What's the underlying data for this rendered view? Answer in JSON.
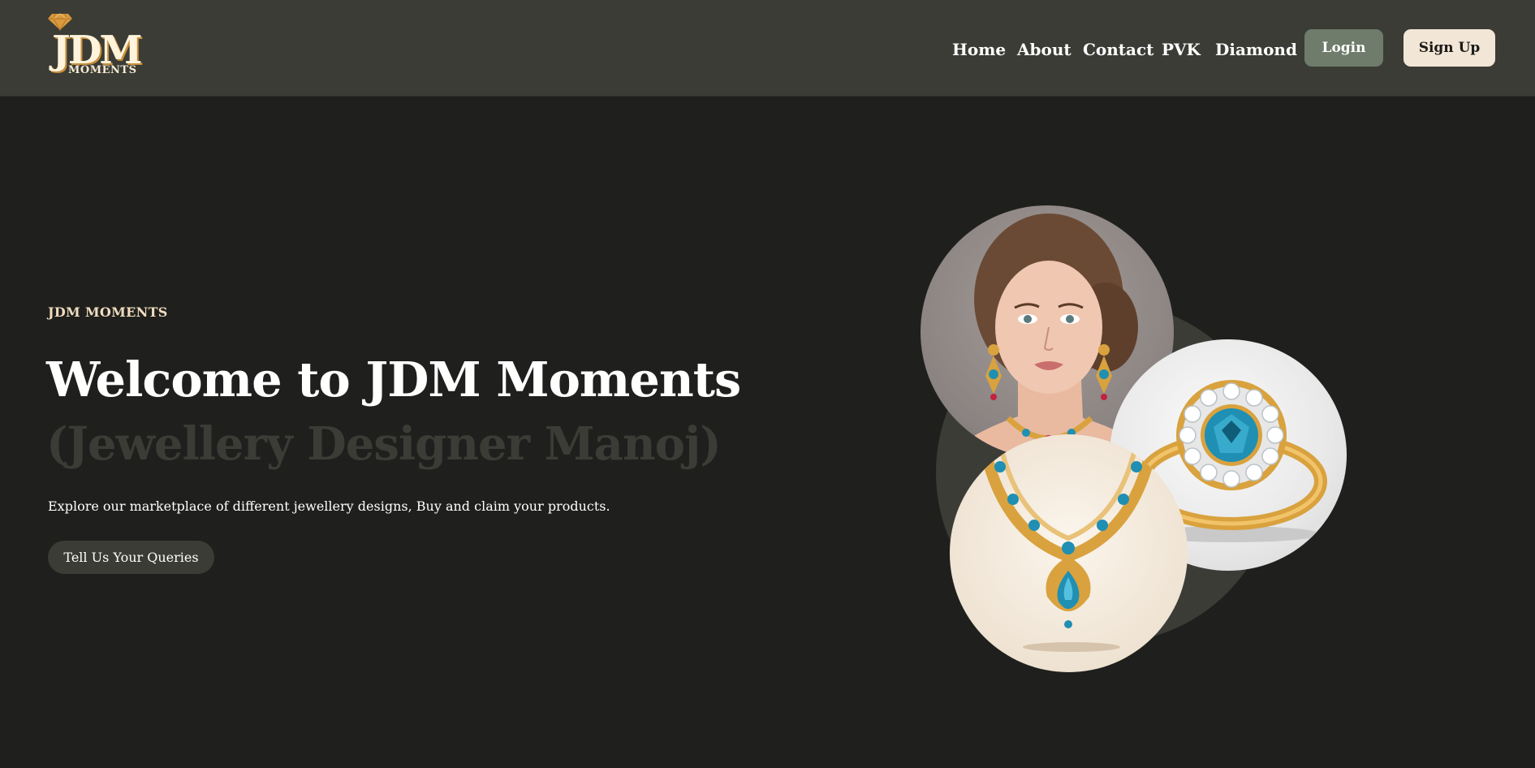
{
  "brand": {
    "logo_main": "JDM",
    "logo_sub": "MOMENTS",
    "gem_color": "#d99a3e"
  },
  "nav": {
    "items": [
      {
        "label": "Home"
      },
      {
        "label": "About"
      },
      {
        "label": "Contact"
      },
      {
        "label": "PVK"
      },
      {
        "label": "Diamond"
      }
    ],
    "login_label": "Login",
    "signup_label": "Sign Up"
  },
  "hero": {
    "eyebrow": "JDM MOMENTS",
    "title": "Welcome to JDM Moments",
    "subtitle": "(Jewellery Designer Manoj)",
    "description": "Explore our marketplace of different jewellery designs, Buy and claim your products.",
    "cta_label": "Tell Us Your Queries"
  },
  "images": {
    "woman": "portrait-illustration",
    "ring": "gemstone-ring-illustration",
    "necklace": "gemstone-necklace-illustration"
  },
  "colors": {
    "header_bg": "#3b3c36",
    "page_bg": "#1f201d",
    "login_bg": "#6f7b6b",
    "signup_bg": "#f2e6d6",
    "accent_gold": "#d99a3e",
    "gem_blue": "#1f8fb3"
  }
}
